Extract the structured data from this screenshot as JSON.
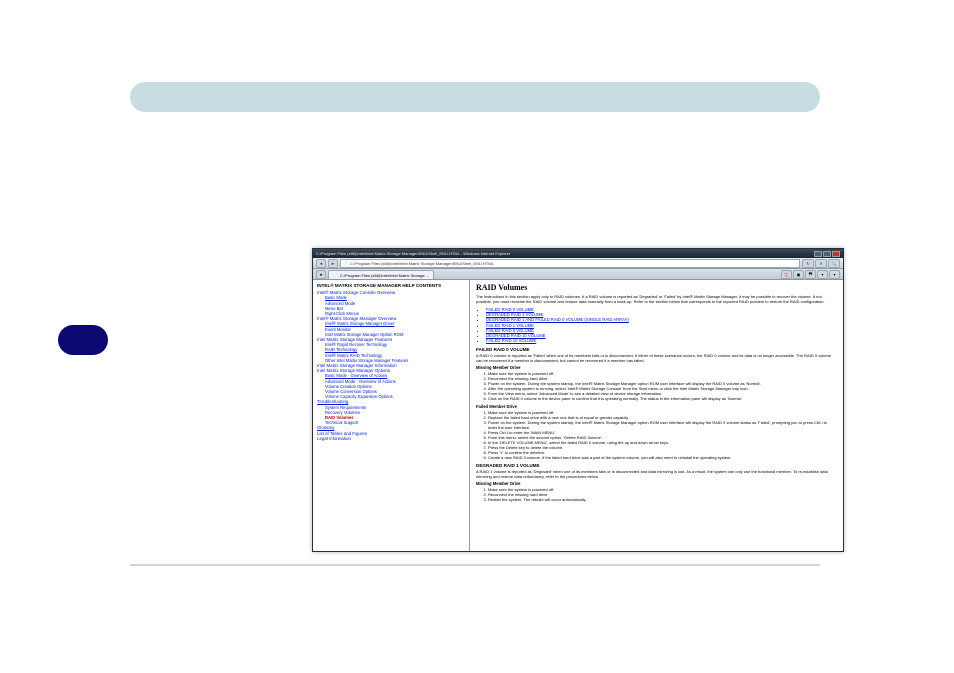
{
  "browser": {
    "window_title": "C:\\Program Files (x86)\\Intel\\Intel Matrix Storage Manager\\ENU\\Shell_ENU.HTML - Windows Internet Explorer",
    "address": "C:\\Program Files (x86)\\Intel\\Intel Matrix Storage Manager\\ENU\\Shell_ENU.HTML",
    "tab_label": "C:\\Program Files (x86)\\Intel\\Intel Matrix Storage ..."
  },
  "toc": {
    "title": "INTEL® MATRIX STORAGE MANAGER HELP CONTENTS",
    "items": [
      {
        "level": 1,
        "label": "Intel® Matrix Storage Console Overview"
      },
      {
        "level": 2,
        "label": "Basic Mode"
      },
      {
        "level": 2,
        "label": "Advanced Mode"
      },
      {
        "level": 2,
        "label": "Menu Bar"
      },
      {
        "level": 2,
        "label": "Right-Click Menus"
      },
      {
        "level": 1,
        "label": "Intel® Matrix Storage Manager Overview"
      },
      {
        "level": 2,
        "label": "Intel® Matrix Storage Manager Driver"
      },
      {
        "level": 2,
        "label": "Event Monitor"
      },
      {
        "level": 2,
        "label": "Intel Matrix Storage Manager Option ROM"
      },
      {
        "level": 1,
        "label": "Intel Matrix Storage Manager Features"
      },
      {
        "level": 2,
        "label": "Intel® Rapid Recover Technology"
      },
      {
        "level": 2,
        "label": "RAID Technology"
      },
      {
        "level": 2,
        "label": "Intel® Matrix RAID Technology"
      },
      {
        "level": 2,
        "label": "Other Intel Matrix Storage Manager Features"
      },
      {
        "level": 1,
        "label": "Intel Matrix Storage Manager Information"
      },
      {
        "level": 1,
        "label": "Intel Matrix Storage Manager Options"
      },
      {
        "level": 2,
        "label": "Basic Mode - Overview of Actions"
      },
      {
        "level": 2,
        "label": "Advanced Mode - Overview of Actions"
      },
      {
        "level": 2,
        "label": "Volume Creation Options"
      },
      {
        "level": 2,
        "label": "Volume Conversion Options"
      },
      {
        "level": 2,
        "label": "Volume Capacity Expansion Options"
      },
      {
        "level": 1,
        "label": "Troubleshooting"
      },
      {
        "level": 2,
        "label": "System Requirements"
      },
      {
        "level": 2,
        "label": "Recovery Volumes"
      },
      {
        "level": 2,
        "label": "RAID Volumes",
        "current": true
      },
      {
        "level": 2,
        "label": "Technical Support"
      },
      {
        "level": 1,
        "label": "Glossary"
      },
      {
        "level": 1,
        "label": "List of Tables and Figures"
      },
      {
        "level": 1,
        "label": "Legal Information"
      }
    ]
  },
  "main": {
    "title": "RAID Volumes",
    "intro": "The instructions in this section apply only to RAID volumes. If a RAID volume is reported as 'Degraded' or 'Failed' by Intel® Matrix Storage Manager, it may be possible to recover the volume. If not possible, you must recreate the RAID volume and restore data manually from a back-up. Refer to the section below that corresponds to the reported RAID problem to restore the RAID configuration.",
    "anchors": [
      "FAILED RAID 0 VOLUME",
      "DEGRADED RAID 1 VOLUME",
      "DEGRADED RAID 1 AND FAILED RAID 0 VOLUME (SINGLE RAID ARRAY)",
      "FAILED RAID 1 VOLUME",
      "FAILED RAID 5 VOLUME",
      "DEGRADED RAID 10 VOLUME",
      "FAILED RAID 10 VOLUME"
    ],
    "sec1": {
      "heading": "FAILED RAID 0 VOLUME",
      "desc": "A RAID 0 volume is reported as 'Failed' when one of its members fails or is disconnected. If either of these scenarios occurs, the RAID 0 volume and its data is no longer accessible. The RAID 0 volume can be recovered if a member is disconnected, but cannot be recovered if a member has failed.",
      "sub1": {
        "heading": "Missing Member Drive",
        "steps": [
          "Make sure the system is powered off.",
          "Reconnect the missing hard drive.",
          "Power on the system. During the system startup, the Intel® Matrix Storage Manager option ROM user interface will display the RAID 0 volume as 'Normal'.",
          "After the operating system is running, select 'Intel® Matrix Storage Console' from the Start menu or click the Intel Matrix Storage Manager tray icon.",
          "From the View menu, select 'Advanced Mode' to see a detailed view of device storage information.",
          "Click on the RAID 0 volume in the device pane to confirm that it is operating normally. The status in the information pane will display as 'Normal'."
        ]
      },
      "sub2": {
        "heading": "Failed Member Drive",
        "steps": [
          "Make sure the system is powered off.",
          "Replace the failed hard drive with a new one that is of equal or greater capacity.",
          "Power on the system. During the system startup, the Intel® Matrix Storage Manager option ROM user interface will display the RAID 0 volume status as 'Failed', prompting you to press Ctrl-I to enter the user interface.",
          "Press Ctrl-I to enter the 'MAIN MENU'.",
          "From this menu, select the second option, 'Delete RAID Volume'.",
          "In the 'DELETE VOLUME MENU', select the failed RAID 0 volume, using the up and down arrow keys.",
          "Press the Delete key to delete the volume.",
          "Press 'Y' to confirm the deletion.",
          "Create a new RAID 0 volume. If the failed hard drive was a part of the system volume, you will also need to reinstall the operating system."
        ]
      }
    },
    "sec2": {
      "heading": "DEGRADED RAID 1 VOLUME",
      "desc": "A RAID 1 volume is reported as 'Degraded' when one of its members fails or is disconnected and data mirroring is lost. As a result, the system can only use the functional member. To re-establish data mirroring and restore data redundancy, refer to the procedures below.",
      "sub1": {
        "heading": "Missing Member Drive",
        "steps": [
          "Make sure the system is powered off.",
          "Reconnect the missing hard drive.",
          "Restart the system. The rebuild will occur automatically."
        ]
      }
    }
  }
}
